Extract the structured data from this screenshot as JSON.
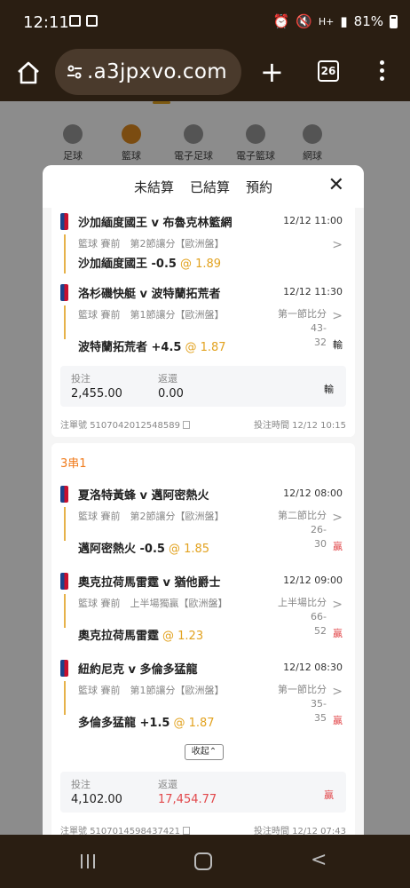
{
  "status_bar": {
    "time": "12:11",
    "network": "H+",
    "battery": "81%"
  },
  "browser": {
    "url": ".a3jpxvo.com",
    "tab_count": "26"
  },
  "sports": [
    {
      "label": "足球"
    },
    {
      "label": "籃球"
    },
    {
      "label": "電子足球"
    },
    {
      "label": "電子籃球"
    },
    {
      "label": "網球"
    }
  ],
  "tabs": {
    "unsettled": "未結算",
    "settled": "已結算",
    "reserved": "預約"
  },
  "bet1": {
    "legs": [
      {
        "match": "沙加緬度國王 v 布魯克林籃網",
        "time": "12/12 11:00",
        "info": "籃球 賽前　第2節讓分【歐洲盤】",
        "score_line1": "",
        "score_line2": "",
        "pick": "沙加緬度國王 -0.5",
        "odds": "@ 1.89",
        "result": ""
      },
      {
        "match": "洛杉磯快艇 v 波特蘭拓荒者",
        "time": "12/12 11:30",
        "info": "籃球 賽前　第1節讓分【歐洲盤】",
        "score_line1": "第一節比分 43-",
        "score_line2": "32",
        "pick": "波特蘭拓荒者 +4.5",
        "odds": "@ 1.87",
        "result": "輸"
      }
    ],
    "stake_label": "投注",
    "stake_value": "2,455.00",
    "return_label": "返還",
    "return_value": "0.00",
    "status": "輸",
    "order_label": "注單號",
    "order_no": "5107042012548589",
    "bet_time_label": "投注時間",
    "bet_time": "12/12 10:15"
  },
  "bet2": {
    "label": "3串1",
    "legs": [
      {
        "match": "夏洛特黃蜂 v 邁阿密熱火",
        "time": "12/12 08:00",
        "info": "籃球 賽前　第2節讓分【歐洲盤】",
        "score_line1": "第二節比分 26-",
        "score_line2": "30",
        "pick": "邁阿密熱火 -0.5",
        "odds": "@ 1.85",
        "result": "贏"
      },
      {
        "match": "奧克拉荷馬雷霆 v 猶他爵士",
        "time": "12/12 09:00",
        "info": "籃球 賽前　上半場獨贏【歐洲盤】",
        "score_line1": "上半場比分 66-",
        "score_line2": "52",
        "pick": "奧克拉荷馬雷霆",
        "odds": "@ 1.23",
        "result": "贏"
      },
      {
        "match": "紐約尼克 v 多倫多猛龍",
        "time": "12/12 08:30",
        "info": "籃球 賽前　第1節讓分【歐洲盤】",
        "score_line1": "第一節比分 35-",
        "score_line2": "35",
        "pick": "多倫多猛龍 +1.5",
        "odds": "@ 1.87",
        "result": "贏"
      }
    ],
    "collapse": "收起",
    "stake_label": "投注",
    "stake_value": "4,102.00",
    "return_label": "返還",
    "return_value": "17,454.77",
    "status": "贏",
    "order_label": "注單號",
    "order_no": "5107014598437421",
    "bet_time_label": "投注時間",
    "bet_time": "12/12 07:43"
  },
  "colors": {
    "accent": "#e2a21f",
    "win": "#e2484b",
    "parlay_label": "#f07a1a",
    "chrome": "#2a1e12"
  }
}
